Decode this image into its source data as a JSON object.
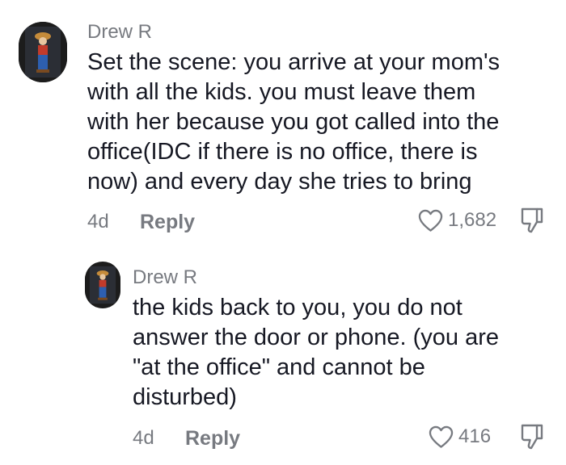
{
  "comments": [
    {
      "username": "Drew R",
      "lines": [
        "Set the scene: you arrive at your mom's",
        "with all the kids. you must leave them",
        "with her because you got called into the",
        "office(IDC if there is no office, there is",
        "now) and every day she tries to bring"
      ],
      "time": "4d",
      "reply_label": "Reply",
      "like_count": "1,682",
      "icons": {
        "avatar": "profile-avatar",
        "like": "heart-outline-icon",
        "dislike": "thumbs-down-icon"
      }
    },
    {
      "username": "Drew R",
      "lines": [
        "the kids back to you, you do not",
        "answer the door or phone. (you are",
        "\"at the office\" and cannot be",
        "disturbed)"
      ],
      "time": "4d",
      "reply_label": "Reply",
      "like_count": "416",
      "icons": {
        "avatar": "profile-avatar",
        "like": "heart-outline-icon",
        "dislike": "thumbs-down-icon"
      }
    }
  ],
  "colors": {
    "text": "#161823",
    "secondary": "#777a80",
    "background": "#ffffff"
  }
}
